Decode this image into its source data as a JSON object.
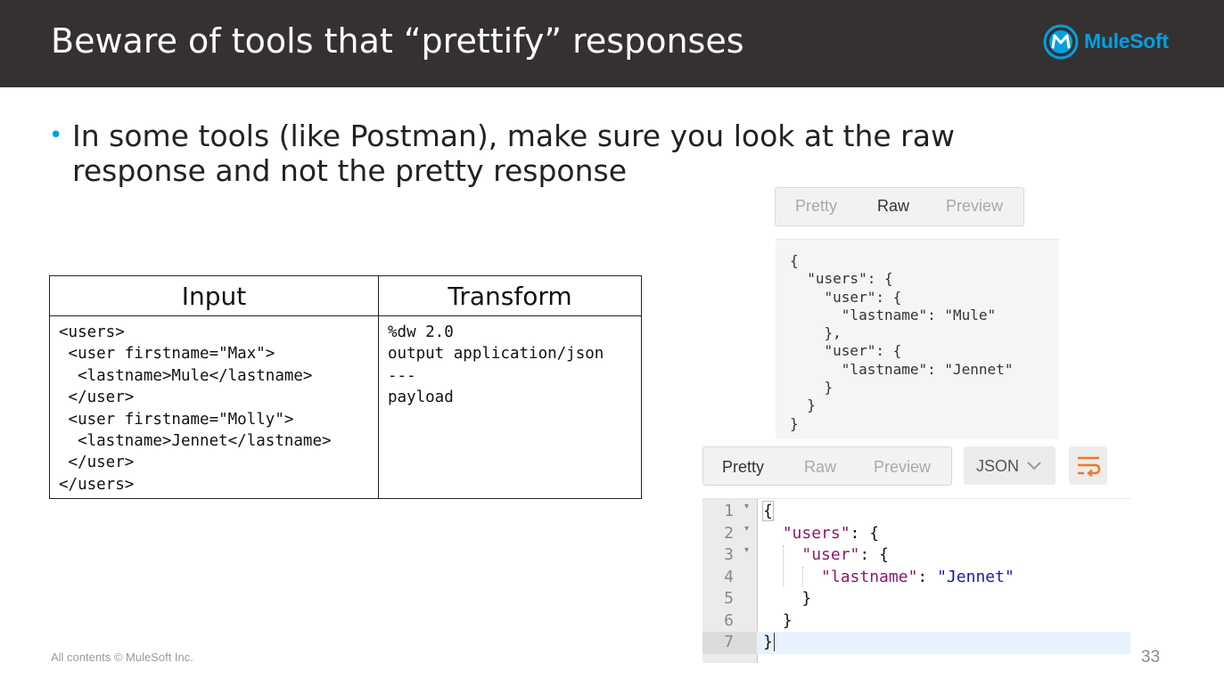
{
  "slide": {
    "title": "Beware of tools that “prettify” responses",
    "logo_text": "MuleSoft",
    "bullet": "In some tools (like Postman), make sure you look at the raw response and not the pretty response",
    "footer": "All contents © MuleSoft Inc.",
    "page_number": "33"
  },
  "table": {
    "headers": [
      "Input",
      "Transform"
    ],
    "input_code": "<users>\n <user firstname=\"Max\">\n  <lastname>Mule</lastname>\n </user>\n <user firstname=\"Molly\">\n  <lastname>Jennet</lastname>\n </user>\n</users>",
    "transform_code": "%dw 2.0\noutput application/json\n---\npayload"
  },
  "raw_view": {
    "tabs": [
      "Pretty",
      "Raw",
      "Preview"
    ],
    "active_tab": "Raw",
    "body": "{\n  \"users\": {\n    \"user\": {\n      \"lastname\": \"Mule\"\n    },\n    \"user\": {\n      \"lastname\": \"Jennet\"\n    }\n  }\n}"
  },
  "pretty_view": {
    "tabs": [
      "Pretty",
      "Raw",
      "Preview"
    ],
    "active_tab": "Pretty",
    "format": "JSON",
    "line_numbers": [
      "1",
      "2",
      "3",
      "4",
      "5",
      "6",
      "7"
    ],
    "lines": {
      "l1": "{",
      "l2_key": "\"users\"",
      "l2_rest": ": {",
      "l3_key": "\"user\"",
      "l3_rest": ": {",
      "l4_key": "\"lastname\"",
      "l4_sep": ": ",
      "l4_val": "\"Jennet\"",
      "l5": "}",
      "l6": "}",
      "l7": "}"
    }
  },
  "colors": {
    "header_bg": "#353131",
    "accent": "#00a0df",
    "wrap_icon": "#f47721",
    "json_key": "#8b1a6b",
    "json_string": "#1a1aa6"
  }
}
